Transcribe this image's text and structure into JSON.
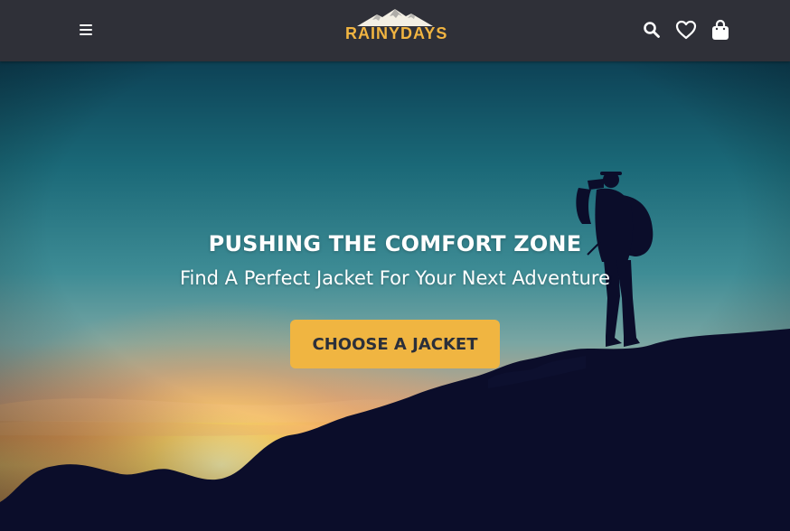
{
  "header": {
    "logo_text": "RAINYDAYS",
    "icons": {
      "menu": "hamburger-menu-icon",
      "search": "search-icon",
      "favorites": "heart-icon",
      "cart": "shopping-bag-icon"
    }
  },
  "hero": {
    "title": "PUSHING THE COMFORT ZONE",
    "subtitle": "Find A Perfect Jacket For Your Next Adventure",
    "cta_label": "CHOOSE A JACKET"
  },
  "colors": {
    "header_bg": "#2f3038",
    "accent": "#f0b541",
    "button_text": "#2b2f3a",
    "sky_top": "#0f4d5f",
    "silhouette": "#0b0d2a"
  }
}
